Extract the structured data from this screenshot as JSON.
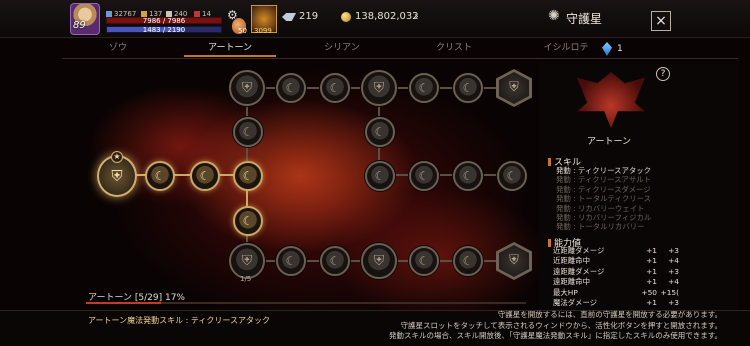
{
  "player": {
    "level": "89",
    "stat_small_1": "32767",
    "stat_small_2": "137",
    "stat_small_3": "240",
    "stat_small_4": "14",
    "hp_text": "7986 / 7986",
    "mp_text": "1483 / 2190",
    "mp_fraction": 0.677,
    "potion_count": "50",
    "skill_slot_count": "3099"
  },
  "currency": {
    "crystal": "219",
    "gold": "138,802,032"
  },
  "header": {
    "title": "守護星",
    "close_icon": "×"
  },
  "tabs": [
    "ゾウ",
    "アートーン",
    "シリアン",
    "クリスト",
    "イシルロテ"
  ],
  "active_tab": 1,
  "gem_count": "1",
  "tree": {
    "node_count": "1/5"
  },
  "progress": {
    "label": "アートーン [5/29]  17%",
    "fraction": 0.17
  },
  "panel": {
    "help_icon": "?",
    "constellation_name": "アートーン",
    "skill_title": "スキル",
    "skills": [
      {
        "text": "発動 : ティクリースアタック",
        "active": true
      },
      {
        "text": "発動 : ティクリースアサルト",
        "active": false
      },
      {
        "text": "発動 : ティクリースダメージ",
        "active": false
      },
      {
        "text": "発動 : トータルティクリース",
        "active": false
      },
      {
        "text": "発動 : リカバリーウェイト",
        "active": false
      },
      {
        "text": "発動 : リカバリーフィジカル",
        "active": false
      },
      {
        "text": "発動 : トータルリカバリー",
        "active": false
      }
    ],
    "stats_title": "能力値",
    "stats": [
      {
        "name": "近距離ダメージ",
        "cur": "+1",
        "max": "+3"
      },
      {
        "name": "近距離命中",
        "cur": "+1",
        "max": "+4"
      },
      {
        "name": "遠距離ダメージ",
        "cur": "+1",
        "max": "+3"
      },
      {
        "name": "遠距離命中",
        "cur": "+1",
        "max": "+4"
      },
      {
        "name": "最大HP",
        "cur": "+50",
        "max": "+15("
      },
      {
        "name": "魔法ダメージ",
        "cur": "+1",
        "max": "+3"
      }
    ]
  },
  "bottom": {
    "left": "アートーン魔法発動スキル : ティクリースアタック",
    "line1": "守護星を開放するには、直前の守護星を開放する必要があります。",
    "line2": "守護星スロットをタッチして表示されるウィンドウから、活性化ボタンを押すと開放されます。",
    "line3": "発動スキルの場合、スキル開放後、「守護星魔法発動スキル」に指定したスキルのみ使用できます。"
  },
  "colors": {
    "accent": "#c6752a",
    "hp": "#7a0f10",
    "mp": "#4a55b8",
    "progress": "#c23a2a",
    "node_lit": "#c9a86a"
  }
}
